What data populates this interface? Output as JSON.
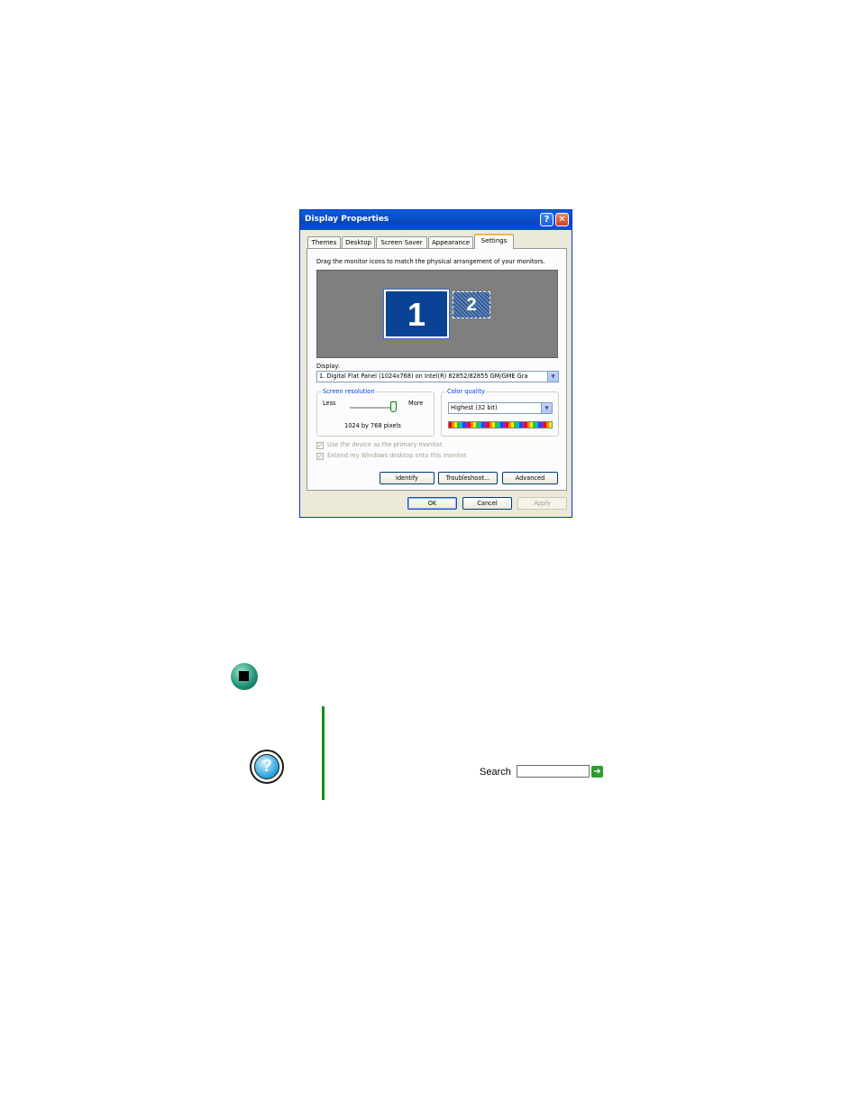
{
  "dialog": {
    "title": "Display Properties",
    "help_glyph": "?",
    "close_glyph": "✕",
    "tabs": [
      {
        "label": "Themes"
      },
      {
        "label": "Desktop"
      },
      {
        "label": "Screen Saver"
      },
      {
        "label": "Appearance"
      },
      {
        "label": "Settings"
      }
    ],
    "active_tab": "Settings",
    "instructions": "Drag the monitor icons to match the physical arrangement of your monitors.",
    "monitors": [
      {
        "number": "1",
        "selected": true
      },
      {
        "number": "2",
        "selected": false
      }
    ],
    "display_label": "Display:",
    "display_value": "1. Digital Flat Panel (1024x768) on Intel(R) 82852/82855 GM/GME Gra",
    "resolution": {
      "legend": "Screen resolution",
      "less_label": "Less",
      "more_label": "More",
      "value_text": "1024 by 768 pixels",
      "slider_level": 1.0
    },
    "color_quality": {
      "legend": "Color quality",
      "value": "Highest (32 bit)"
    },
    "checkboxes": [
      {
        "label": "Use the device as the primary monitor.",
        "checked": true,
        "disabled": true
      },
      {
        "label": "Extend my Windows desktop onto this monitor.",
        "checked": true,
        "disabled": true
      }
    ],
    "check_glyph": "✓",
    "dropdown_arrow": "▼",
    "buttons": {
      "identify": "Identify",
      "troubleshoot": "Troubleshoot...",
      "advanced": "Advanced",
      "ok": "OK",
      "cancel": "Cancel",
      "apply": "Apply"
    }
  },
  "page": {
    "search_label": "Search",
    "search_value": "",
    "search_go_glyph": "➔",
    "help_glyph": "?",
    "icons": [
      "stop-icon",
      "help-icon",
      "arrow-right-icon"
    ],
    "accent_green": "#1a8a1a"
  }
}
